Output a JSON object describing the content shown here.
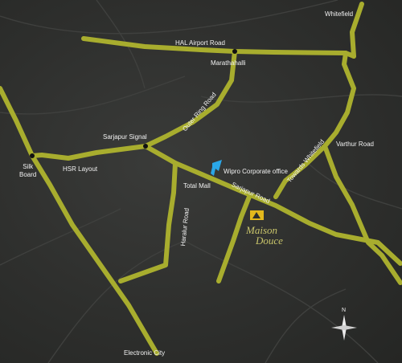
{
  "map": {
    "place_labels": {
      "whitefield": "Whitefield",
      "hal_airport_road": "HAL Airport Road",
      "marathahalli": "Marathahalli",
      "outer_ring_road": "Outer Ring Road",
      "sarjapur_signal": "Sarjapur Signal",
      "silk_board": "Silk\nBoard",
      "hsr_layout": "HSR Layout",
      "varthur_road": "Varthur Road",
      "towards_whitefield": "Towards Whitefield",
      "wipro_corporate_office": "Wipro Corporate office",
      "total_mall": "Total Mall",
      "sarjapur_road": "Sarjapur Road",
      "haralur_road": "Haralur Road",
      "electronic_city": "Electronic City"
    },
    "north_label": "N",
    "project": {
      "line1": "Maison",
      "line2": "Douce"
    },
    "colors": {
      "background": "#2e2f2d",
      "road": "#a8ad2e",
      "label": "#f2f2f2",
      "office_marker": "#2aa7e8",
      "logo_text": "#c8c46a",
      "builder_logo": "#e3b81c"
    },
    "icons": [
      "office-marker-icon",
      "junction-dot-icon",
      "compass-icon",
      "builder-logo-icon"
    ]
  }
}
